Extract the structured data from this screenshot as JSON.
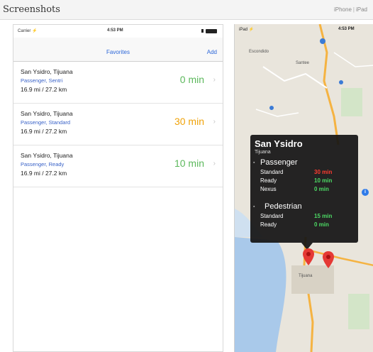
{
  "header": {
    "title": "Screenshots",
    "links": [
      "iPhone",
      "iPad"
    ]
  },
  "phone": {
    "status": {
      "carrier": "Carrier ⚡",
      "time": "4:53 PM"
    },
    "navbar": {
      "title": "Favorites",
      "add_label": "Add"
    },
    "rows": [
      {
        "title": "San Ysidro, Tijuana",
        "subtitle": "Passenger, Sentri",
        "distance": "16.9 mi / 27.2 km",
        "minutes": "0 min",
        "color": "#5cb85c"
      },
      {
        "title": "San Ysidro, Tijuana",
        "subtitle": "Passenger, Standard",
        "distance": "16.9 mi / 27.2 km",
        "minutes": "30 min",
        "color": "#f0a30a"
      },
      {
        "title": "San Ysidro, Tijuana",
        "subtitle": "Passenger, Ready",
        "distance": "16.9 mi / 27.2 km",
        "minutes": "10 min",
        "color": "#5cb85c"
      }
    ],
    "chevron": "›"
  },
  "map": {
    "status": {
      "carrier": "iPad ⚡",
      "time": "4:53 PM"
    },
    "labels": [
      "Santee",
      "Escondido",
      "Tijuana"
    ],
    "callout": {
      "title": "San Ysidro",
      "subtitle": "Tijuana",
      "passenger": {
        "label": "Passenger",
        "rows": [
          {
            "key": "Standard",
            "value": "30 min",
            "color": "#ff3b30"
          },
          {
            "key": "Ready",
            "value": "10 min",
            "color": "#4cd964"
          },
          {
            "key": "Nexus",
            "value": "0 min",
            "color": "#4cd964"
          }
        ]
      },
      "pedestrian": {
        "label": "Pedestrian",
        "rows": [
          {
            "key": "Standard",
            "value": "15 min",
            "color": "#4cd964"
          },
          {
            "key": "Ready",
            "value": "0 min",
            "color": "#4cd964"
          }
        ]
      },
      "info": "i"
    },
    "colors": {
      "pin": "#e53935",
      "highway": "#f5b342",
      "water": "#a9c9ea",
      "land": "#e9e5dc"
    }
  }
}
